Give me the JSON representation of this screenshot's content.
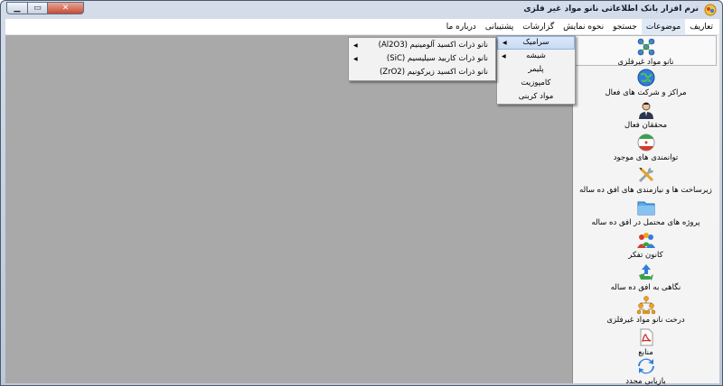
{
  "window": {
    "title": "نرم افزار بانک اطلاعاتی نانو مواد غیر فلزی",
    "controls": {
      "minimize": "▁",
      "maximize": "▭",
      "close": "✕"
    }
  },
  "menubar": {
    "items": [
      "تعاریف",
      "موضوعات",
      "جستجو",
      "نحوه نمایش",
      "گزارشات",
      "پشتیبانی",
      "درباره ما"
    ]
  },
  "sidebar": {
    "items": [
      {
        "label": "نانو مواد غیرفلزی",
        "icon": "molecule-icon"
      },
      {
        "label": "مراکز و شرکت های فعال",
        "icon": "globe-icon"
      },
      {
        "label": "محققان فعال",
        "icon": "researcher-icon"
      },
      {
        "label": "توانمندی های موجود",
        "icon": "iran-flag-icon"
      },
      {
        "label": "زیرساخت ها و نیازمندی های افق ده ساله",
        "icon": "tools-icon"
      },
      {
        "label": "پروژه های محتمل در افق ده ساله",
        "icon": "folder-icon"
      },
      {
        "label": "کانون تفکر",
        "icon": "people-group-icon"
      },
      {
        "label": "نگاهی به افق ده ساله",
        "icon": "recycle-arrows-icon"
      },
      {
        "label": "درخت نانو مواد غیرفلزی",
        "icon": "org-tree-icon"
      },
      {
        "label": "منابع",
        "icon": "pdf-icon"
      },
      {
        "label": "بازیابی مجدد",
        "icon": "refresh-icon"
      }
    ]
  },
  "menu_primary": {
    "items": [
      "سرامیک",
      "شیشه",
      "پلیمر",
      "کامپوزیت",
      "مواد کربنی"
    ]
  },
  "menu_secondary": {
    "items": [
      "نانو ذرات اکسید آلومینیم (Al2O3)",
      "نانو ذرات کاربید سیلیسیم (SiC)",
      "نانو ذرات اکسید زیرکونیم (ZrO2)"
    ]
  },
  "colors": {
    "client_bg": "#a9a9a9",
    "sidebar_bg": "#f4f4f4",
    "highlight": "#c7dbf3"
  }
}
